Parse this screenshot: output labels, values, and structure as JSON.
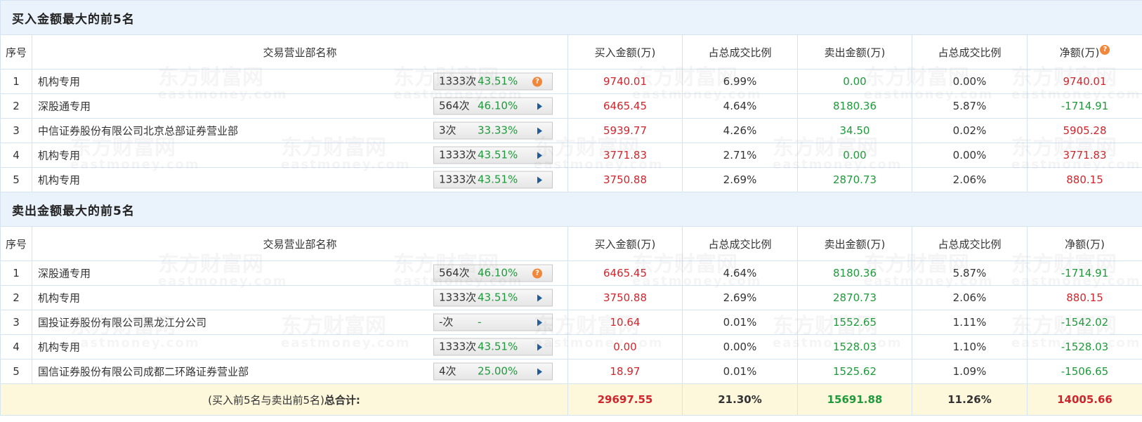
{
  "watermark": {
    "cn": "东方财富网",
    "en": "eastmoney.com"
  },
  "buy_section": {
    "title": "买入金额最大的前5名",
    "headers": [
      "序号",
      "交易营业部名称",
      "买入金额(万)",
      "占总成交比例",
      "卖出金额(万)",
      "占总成交比例",
      "净额(万)"
    ],
    "help_mark": "?",
    "rows": [
      {
        "idx": "1",
        "name": "机构专用",
        "count": "1333次",
        "pct": "43.51%",
        "buy": "9740.01",
        "buy_ratio": "6.99%",
        "sell": "0.00",
        "sell_ratio": "0.00%",
        "net": "9740.01",
        "net_color": "red",
        "badge": "help"
      },
      {
        "idx": "2",
        "name": "深股通专用",
        "count": "564次",
        "pct": "46.10%",
        "buy": "6465.45",
        "buy_ratio": "4.64%",
        "sell": "8180.36",
        "sell_ratio": "5.87%",
        "net": "-1714.91",
        "net_color": "green",
        "badge": "arrow"
      },
      {
        "idx": "3",
        "name": "中信证券股份有限公司北京总部证券营业部",
        "count": "3次",
        "pct": "33.33%",
        "buy": "5939.77",
        "buy_ratio": "4.26%",
        "sell": "34.50",
        "sell_ratio": "0.02%",
        "net": "5905.28",
        "net_color": "red",
        "badge": "arrow"
      },
      {
        "idx": "4",
        "name": "机构专用",
        "count": "1333次",
        "pct": "43.51%",
        "buy": "3771.83",
        "buy_ratio": "2.71%",
        "sell": "0.00",
        "sell_ratio": "0.00%",
        "net": "3771.83",
        "net_color": "red",
        "badge": "arrow"
      },
      {
        "idx": "5",
        "name": "机构专用",
        "count": "1333次",
        "pct": "43.51%",
        "buy": "3750.88",
        "buy_ratio": "2.69%",
        "sell": "2870.73",
        "sell_ratio": "2.06%",
        "net": "880.15",
        "net_color": "red",
        "badge": "arrow"
      }
    ]
  },
  "sell_section": {
    "title": "卖出金额最大的前5名",
    "headers": [
      "序号",
      "交易营业部名称",
      "买入金额(万)",
      "占总成交比例",
      "卖出金额(万)",
      "占总成交比例",
      "净额(万)"
    ],
    "rows": [
      {
        "idx": "1",
        "name": "深股通专用",
        "count": "564次",
        "pct": "46.10%",
        "buy": "6465.45",
        "buy_ratio": "4.64%",
        "sell": "8180.36",
        "sell_ratio": "5.87%",
        "net": "-1714.91",
        "net_color": "green",
        "badge": "help"
      },
      {
        "idx": "2",
        "name": "机构专用",
        "count": "1333次",
        "pct": "43.51%",
        "buy": "3750.88",
        "buy_ratio": "2.69%",
        "sell": "2870.73",
        "sell_ratio": "2.06%",
        "net": "880.15",
        "net_color": "red",
        "badge": "arrow"
      },
      {
        "idx": "3",
        "name": "国投证券股份有限公司黑龙江分公司",
        "count": "-次",
        "pct": "-",
        "buy": "10.64",
        "buy_ratio": "0.01%",
        "sell": "1552.65",
        "sell_ratio": "1.11%",
        "net": "-1542.02",
        "net_color": "green",
        "badge": "arrow"
      },
      {
        "idx": "4",
        "name": "机构专用",
        "count": "1333次",
        "pct": "43.51%",
        "buy": "0.00",
        "buy_ratio": "0.00%",
        "sell": "1528.03",
        "sell_ratio": "1.10%",
        "net": "-1528.03",
        "net_color": "green",
        "badge": "arrow"
      },
      {
        "idx": "5",
        "name": "国信证券股份有限公司成都二环路证券营业部",
        "count": "4次",
        "pct": "25.00%",
        "buy": "18.97",
        "buy_ratio": "0.01%",
        "sell": "1525.62",
        "sell_ratio": "1.09%",
        "net": "-1506.65",
        "net_color": "green",
        "badge": "arrow"
      }
    ]
  },
  "total": {
    "label_prefix": "(买入前5名与卖出前5名)",
    "label_bold": "总合计:",
    "buy": "29697.55",
    "buy_ratio": "21.30%",
    "sell": "15691.88",
    "sell_ratio": "11.26%",
    "net": "14005.66"
  },
  "colors": {
    "up": "#d0252c",
    "down": "#1e9a3b",
    "section_bg": "#eaf3fb",
    "total_bg": "#fdf7dc",
    "border": "#d6e4f0"
  }
}
